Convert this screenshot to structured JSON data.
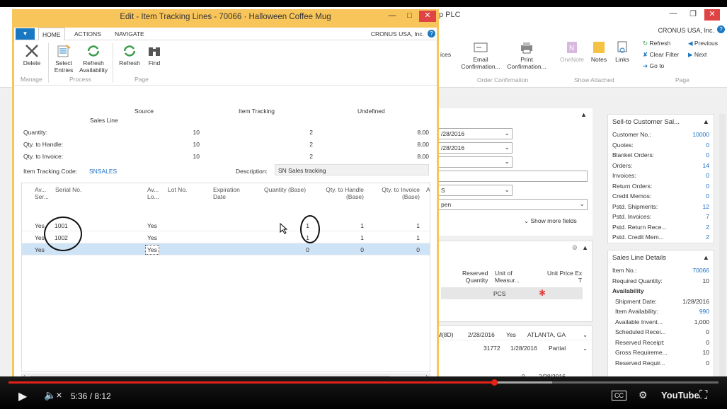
{
  "bg_window": {
    "title_fragment": "p PLC",
    "company": "CRONUS USA, Inc.",
    "ribbon": {
      "share_fragment": "ices",
      "email": "Email\nConfirmation...",
      "print": "Print\nConfirmation...",
      "onenote": "OneNote",
      "notes": "Notes",
      "links": "Links",
      "refresh": "Refresh",
      "clear_filter": "Clear Filter",
      "go_to": "Go to",
      "previous": "Previous",
      "next": "Next",
      "group_order_confirmation": "Order Confirmation",
      "group_show_attached": "Show Attached",
      "group_page": "Page"
    },
    "header_fields": {
      "date1": "/28/2016",
      "date2": "/28/2016",
      "field5": "S",
      "status": "pen",
      "show_more": "Show more fields"
    },
    "lines": {
      "col_reserved": "Reserved\nQuantity",
      "col_uom": "Unit of\nMeasur...",
      "col_price": "Unit Price Ex\nT",
      "uom_value": "PCS"
    },
    "bottom_rows": [
      {
        "c1": "M(8D)",
        "c2": "2/28/2016",
        "c3": "Yes",
        "c4": "ATLANTA, GA"
      },
      {
        "c1": "31772",
        "c2": "1/28/2016",
        "c3": "Partial"
      },
      {
        "c1": "0",
        "c2": "2/28/2016"
      }
    ],
    "factbox1": {
      "title": "Sell-to Customer Sal...",
      "rows": [
        {
          "k": "Customer No.:",
          "v": "10000"
        },
        {
          "k": "Quotes:",
          "v": "0"
        },
        {
          "k": "Blanket Orders:",
          "v": "0"
        },
        {
          "k": "Orders:",
          "v": "14"
        },
        {
          "k": "Invoices:",
          "v": "0"
        },
        {
          "k": "Return Orders:",
          "v": "0"
        },
        {
          "k": "Credit Memos:",
          "v": "0"
        },
        {
          "k": "Pstd. Shipments:",
          "v": "12"
        },
        {
          "k": "Pstd. Invoices:",
          "v": "7"
        },
        {
          "k": "Pstd. Return Rece...",
          "v": "2"
        },
        {
          "k": "Pstd. Credit Mem...",
          "v": "2"
        }
      ]
    },
    "factbox2": {
      "title": "Sales Line Details",
      "rows": [
        {
          "k": "Item No.:",
          "v": "70066"
        },
        {
          "k": "Required Quantity:",
          "v": "10"
        },
        {
          "k": "Availability",
          "v": ""
        },
        {
          "k": "Shipment Date:",
          "v": "1/28/2016"
        },
        {
          "k": "Item Availability:",
          "v": "990"
        },
        {
          "k": "Available Invent...",
          "v": "1,000"
        },
        {
          "k": "Scheduled Recei...",
          "v": "0"
        },
        {
          "k": "Reserved Receipt:",
          "v": "0"
        },
        {
          "k": "Gross Requireme...",
          "v": "10"
        },
        {
          "k": "Reserved Requir...",
          "v": "0"
        }
      ]
    }
  },
  "dialog": {
    "title": "Edit - Item Tracking Lines - 70066 · Halloween Coffee Mug",
    "company": "CRONUS USA, Inc.",
    "tabs": [
      "HOME",
      "ACTIONS",
      "NAVIGATE"
    ],
    "actions": {
      "delete": "Delete",
      "select_entries": "Select\nEntries",
      "refresh_availability": "Refresh\nAvailability",
      "refresh": "Refresh",
      "find": "Find"
    },
    "groups": {
      "manage": "Manage",
      "process": "Process",
      "page": "Page"
    },
    "summary": {
      "col_source": "Source",
      "col_item_tracking": "Item Tracking",
      "col_undefined": "Undefined",
      "sales_line": "Sales Line",
      "rows": [
        {
          "label": "Quantity:",
          "source": "10",
          "tracking": "2",
          "undefined": "8.00"
        },
        {
          "label": "Qty. to Handle:",
          "source": "10",
          "tracking": "2",
          "undefined": "8.00"
        },
        {
          "label": "Qty. to Invoice:",
          "source": "10",
          "tracking": "2",
          "undefined": "8.00"
        }
      ]
    },
    "item_tracking_code_label": "Item Tracking Code:",
    "item_tracking_code": "SNSALES",
    "description_label": "Description:",
    "description": "SN Sales tracking",
    "grid": {
      "headers": {
        "av_ser": "Av...\nSer...",
        "serial": "Serial No.",
        "av_lo": "Av...\nLo...",
        "lot": "Lot No.",
        "exp": "Expiration\nDate",
        "qty_base": "Quantity (Base)",
        "handle": "Qty. to Handle\n(Base)",
        "invoice": "Qty. to Invoice\n(Base)",
        "extra": "A"
      },
      "rows": [
        {
          "av": "Yes",
          "serial": "1001",
          "avlot": "Yes",
          "qty": "1",
          "handle": "1",
          "invoice": "1"
        },
        {
          "av": "Yes",
          "serial": "1002",
          "avlot": "Yes",
          "qty": "1",
          "handle": "1",
          "invoice": "1"
        },
        {
          "av": "Yes",
          "serial": "",
          "avlot": "Yes",
          "qty": "0",
          "handle": "0",
          "invoice": "0"
        }
      ]
    },
    "ok": "OK"
  },
  "player": {
    "time": "5:36 / 8:12",
    "progress_played": 0.684,
    "progress_buffered": 0.766,
    "youtube": "YouTube"
  }
}
